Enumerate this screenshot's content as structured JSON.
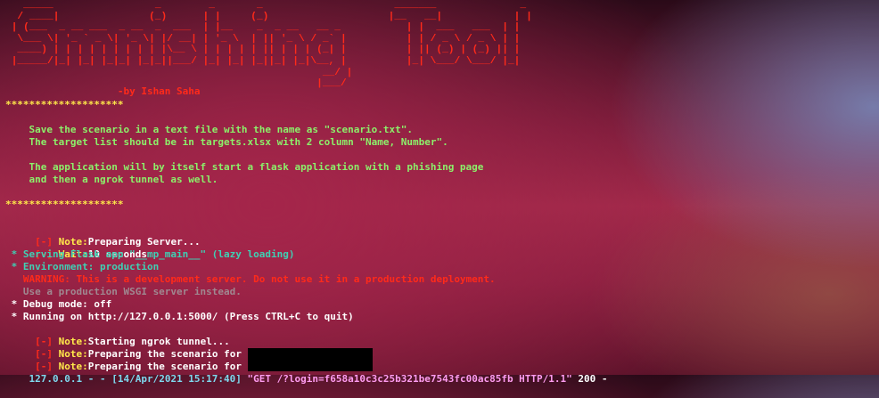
{
  "banner": {
    "ascii_art": "   _____                 _        _       _                      _______              _\n  / ____|               (_)      | |     (_)                    |__   __|            | |\n | (___  _ __ ___  _ __  _  ___  | |__    _  _ __   __ _           | |  ___   ___  | |\n  \\___ \\| '_ ` _ \\| '_ \\| |/ __| | '_ \\  | || '_ \\ / _` |          | | / _ \\ / _ \\ | |\n  ____) | | | | | | | | | |\\__ \\ | | | | | || | | | (_| |          | || (_) | (_) || |\n |_____/|_| |_| |_|_| |_|_||___/ |_| |_| |_||_| |_|\\__, |          |_| \\___/ \\___/ |_|\n                                                     __/ |\n                                                    |___/",
    "author": "                   -by Ishan Saha"
  },
  "separator": "********************",
  "intro": {
    "line1": "    Save the scenario in a text file with the name as \"scenario.txt\".",
    "line2": "    The target list should be in targets.xlsx with 2 column \"Name, Number\".",
    "line3": "    The application will by itself start a flask application with a phishing page",
    "line4": "    and then a ngrok tunnel as well."
  },
  "log": {
    "note_prefix": " [-] ",
    "note_label": "Note:",
    "wait_label": "Wait:",
    "preparing_server": "Preparing Server...",
    "wait_value": "10 seconds",
    "serving_flask": " * Serving Flask app \"__mp_main__\" (lazy loading)",
    "environment": " * Environment: production",
    "warning": "   WARNING: This is a development server. Do not use it in a production deployment.",
    "use_production": "   Use a production WSGI server instead.",
    "debug_mode": " * Debug mode: off",
    "running_on": " * Running on http://127.0.0.1:5000/ (Press CTRL+C to quit)",
    "starting_ngrok": "Starting ngrok tunnel...",
    "preparing_scenario": "Preparing the scenario for ",
    "access_log_prefix": "127.0.0.1 - - [14/Apr/2021 15:17:40] ",
    "access_log_request": "\"GET /?login=f658a10c3c25b321be7543fc00ac85fb HTTP/1.1\"",
    "access_log_suffix": " 200 -"
  },
  "colors": {
    "red": "#ff2a1a",
    "yellow": "#ffe94a",
    "green": "#8cf06a",
    "teal": "#3fd0b4"
  }
}
